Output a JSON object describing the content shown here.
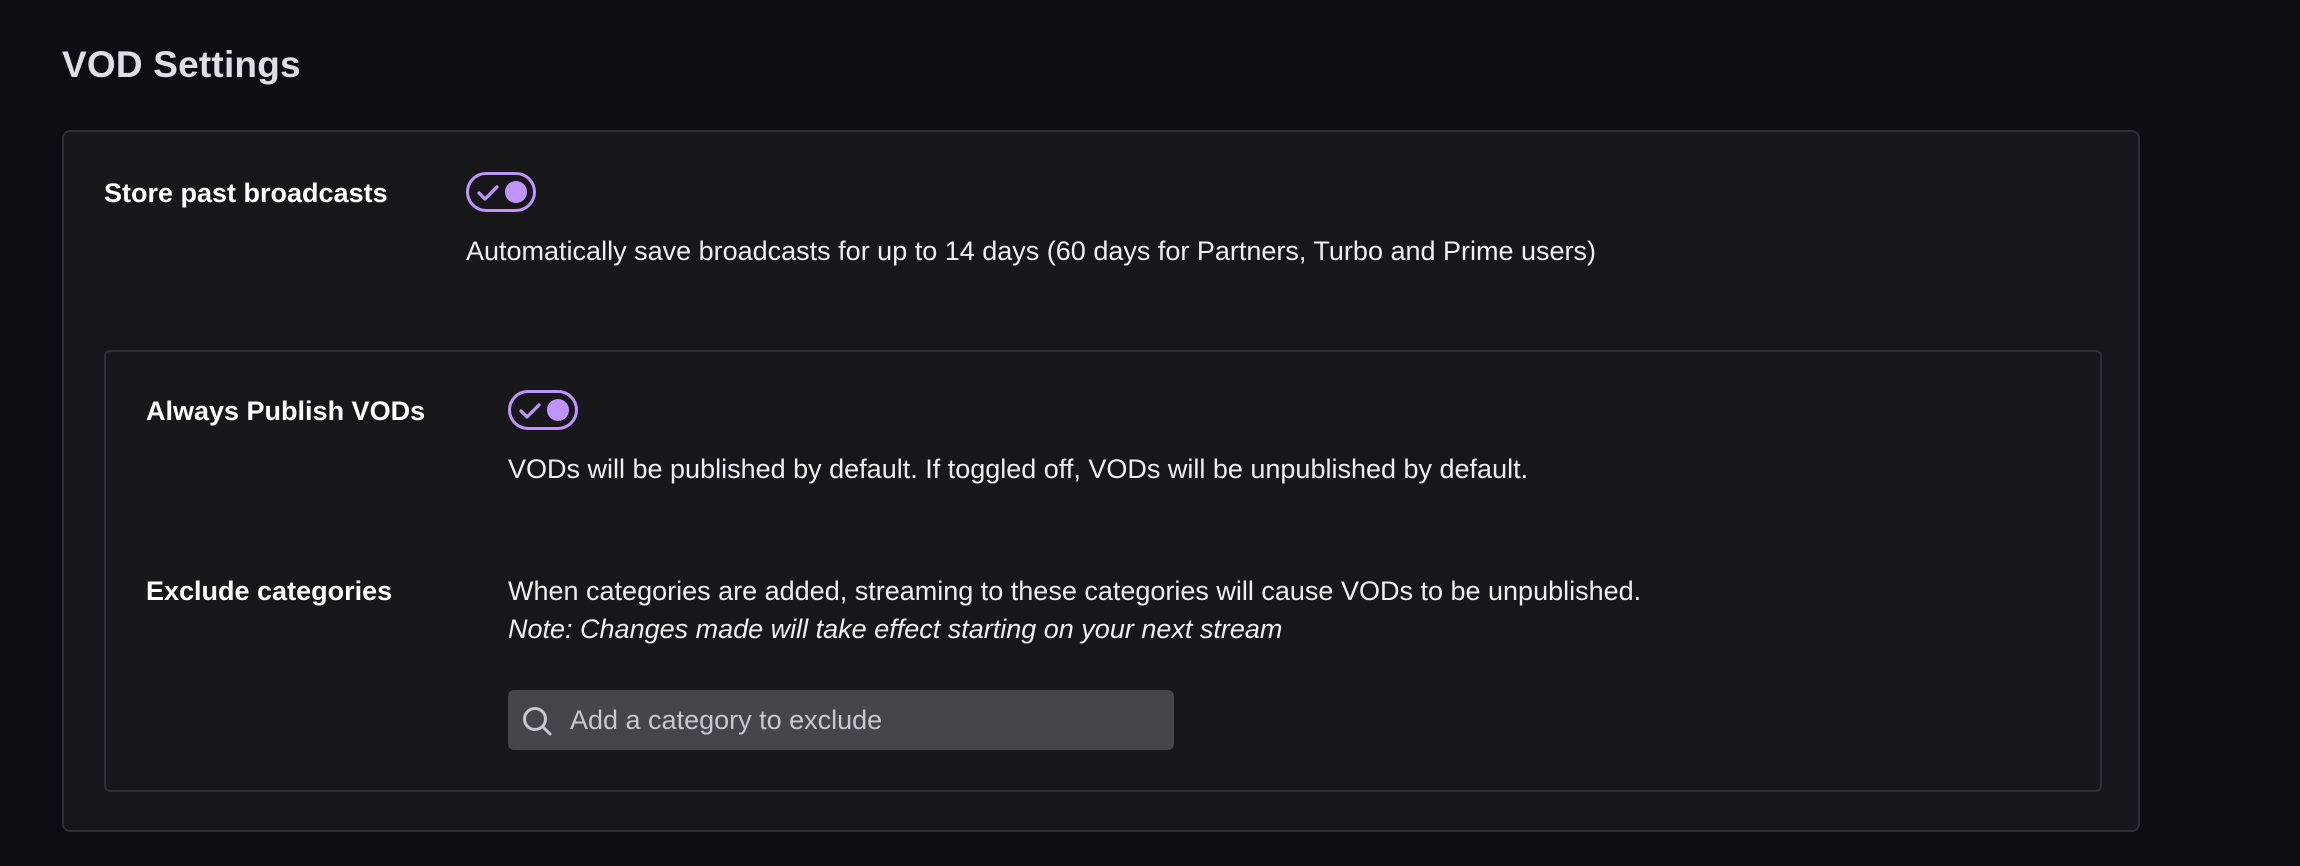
{
  "page": {
    "title": "VOD Settings"
  },
  "store_past_broadcasts": {
    "label": "Store past broadcasts",
    "enabled": true,
    "description": "Automatically save broadcasts for up to 14 days (60 days for Partners, Turbo and Prime users)"
  },
  "always_publish_vods": {
    "label": "Always Publish VODs",
    "enabled": true,
    "description": "VODs will be published by default. If toggled off, VODs will be unpublished by default."
  },
  "exclude_categories": {
    "label": "Exclude categories",
    "description": "When categories are added, streaming to these categories will cause VODs to be unpublished.",
    "note": "Note: Changes made will take effect starting on your next stream",
    "search_placeholder": "Add a category to exclude",
    "search_value": ""
  },
  "theme": {
    "accent": "#bf94ff",
    "background": "#0e0e10",
    "card_background": "#18181b",
    "card_border": "#2f2f35",
    "input_background": "#464649"
  },
  "icons": {
    "toggle_check": "check-icon",
    "search": "search-icon"
  }
}
